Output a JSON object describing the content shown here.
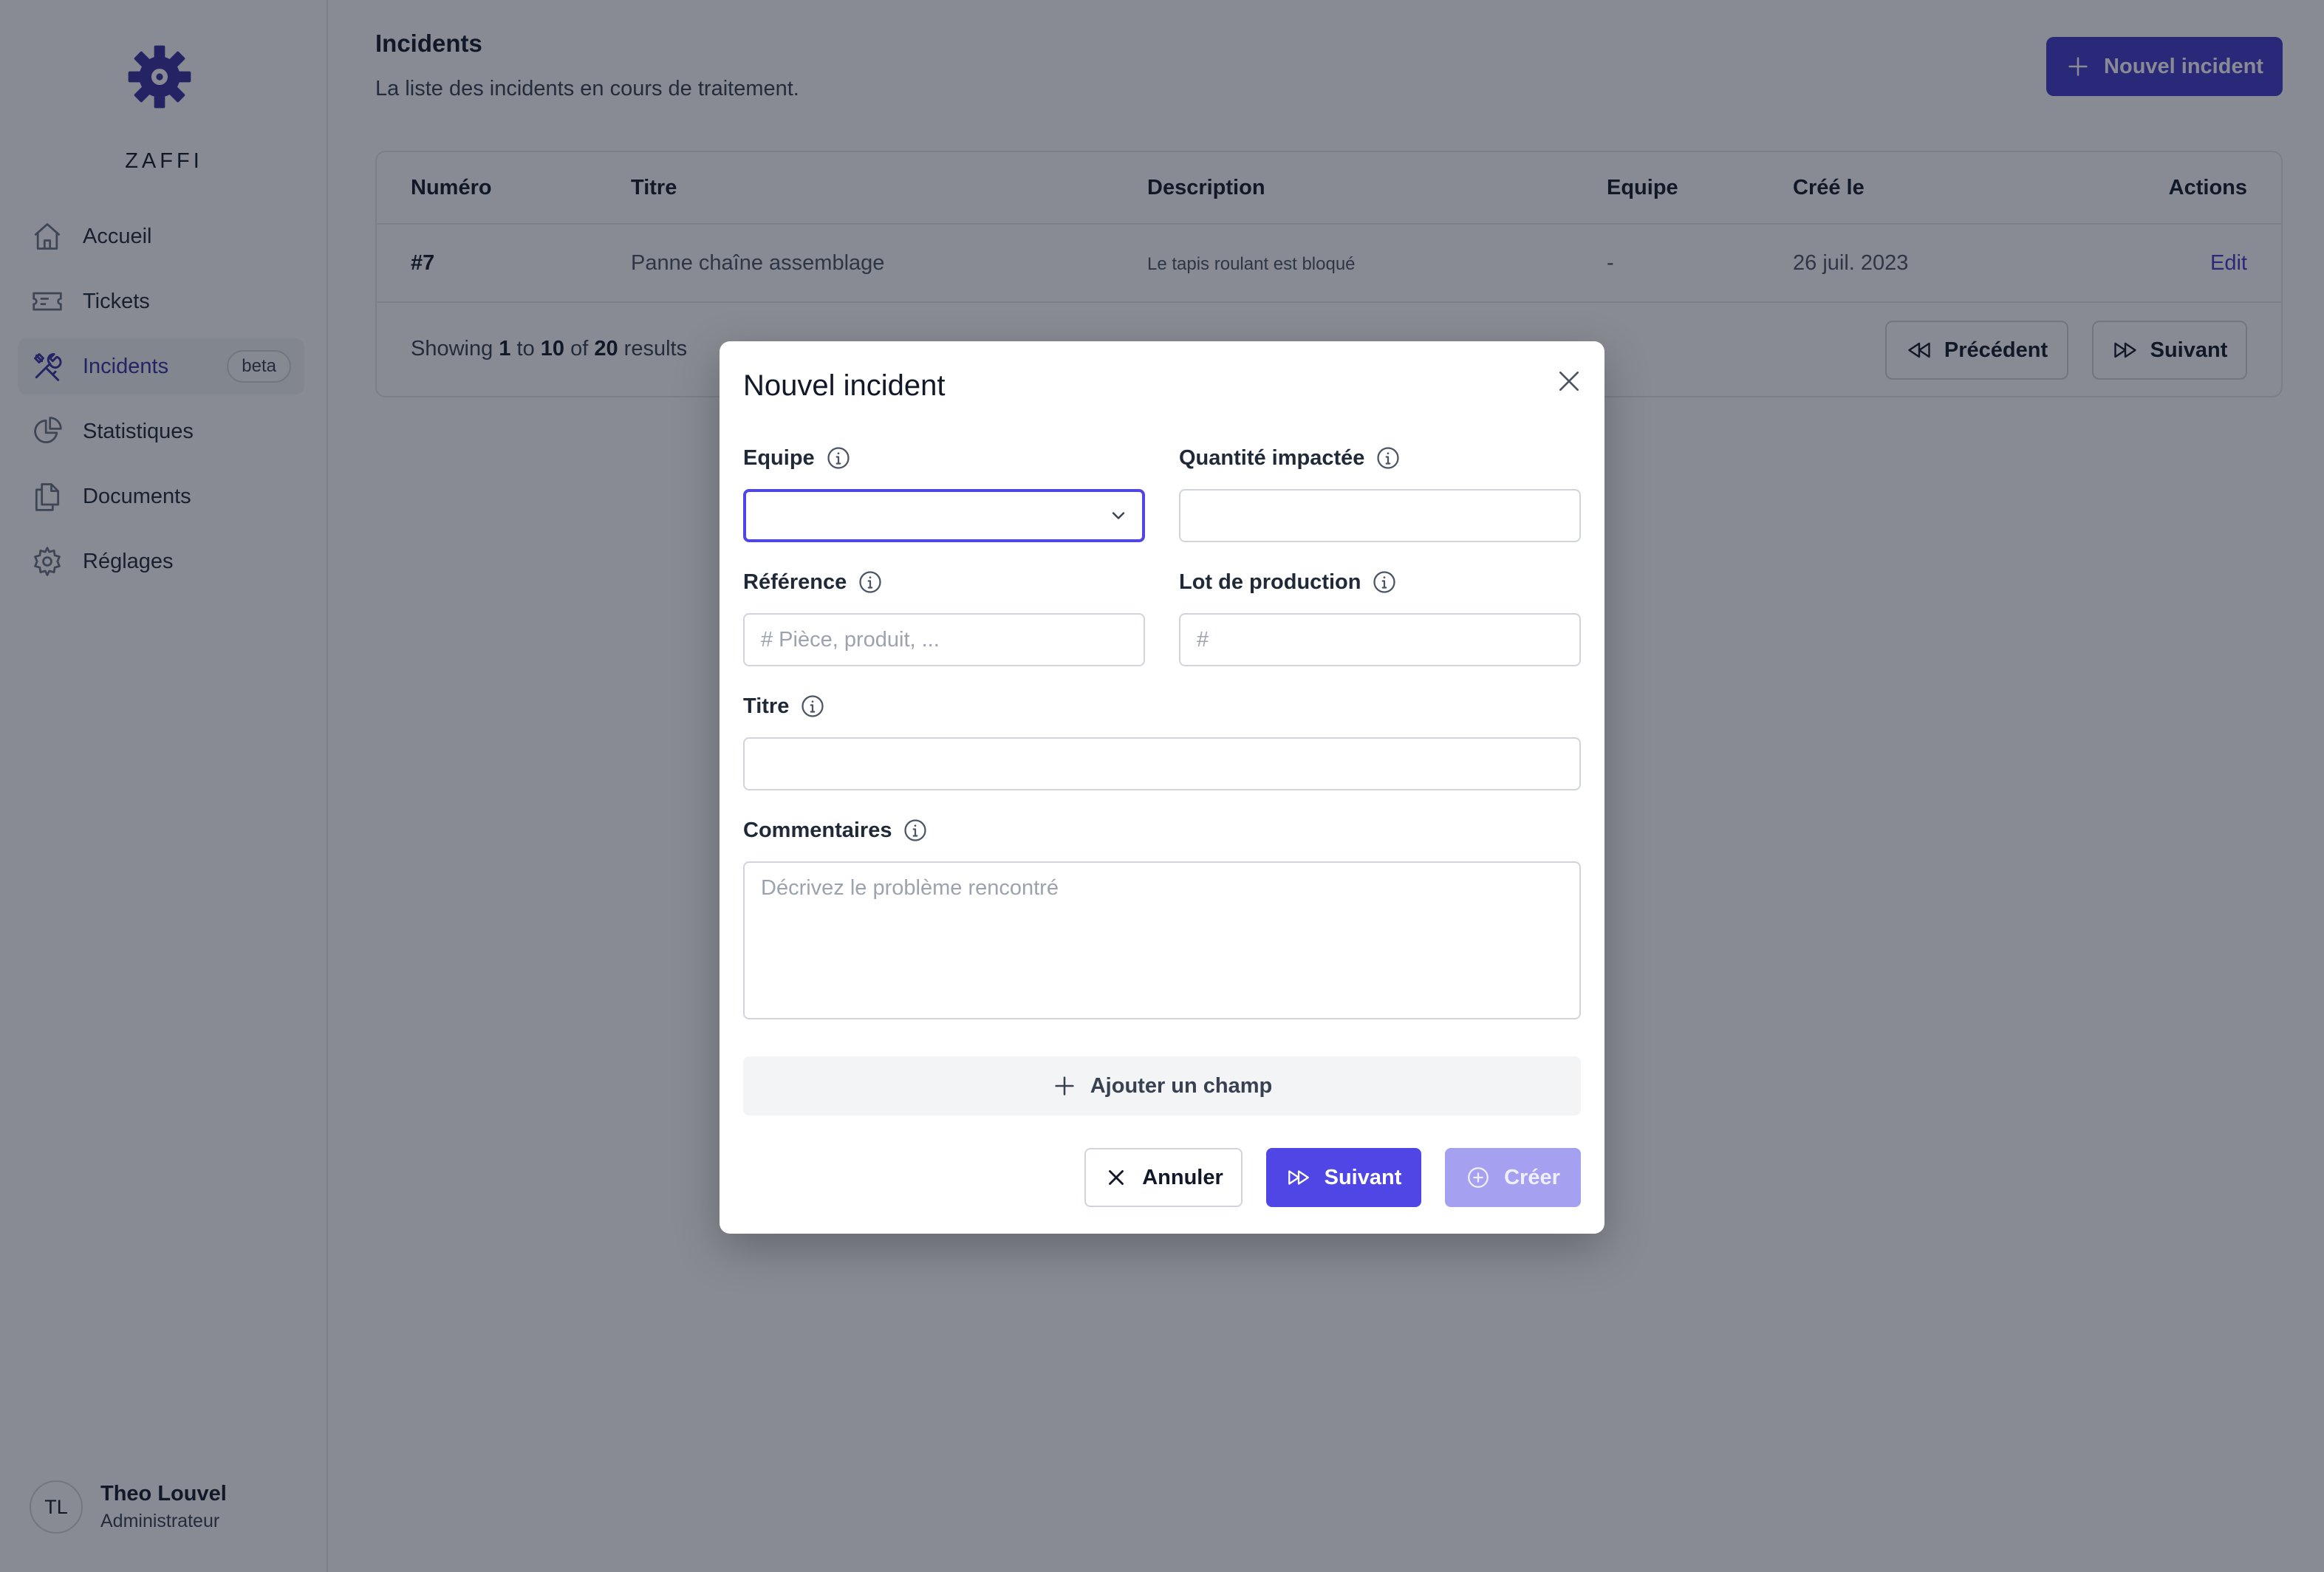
{
  "sidebar": {
    "brand": "ZAFFI",
    "items": [
      {
        "label": "Accueil",
        "icon": "home-icon"
      },
      {
        "label": "Tickets",
        "icon": "ticket-icon"
      },
      {
        "label": "Incidents",
        "icon": "tools-icon",
        "badge": "beta",
        "active": true
      },
      {
        "label": "Statistiques",
        "icon": "pie-chart-icon"
      },
      {
        "label": "Documents",
        "icon": "documents-icon"
      },
      {
        "label": "Réglages",
        "icon": "gear-icon"
      }
    ],
    "user": {
      "initials": "TL",
      "name": "Theo Louvel",
      "role": "Administrateur"
    }
  },
  "header": {
    "title": "Incidents",
    "subtitle": "La liste des incidents en cours de traitement.",
    "new_button": "Nouvel incident"
  },
  "table": {
    "columns": [
      "Numéro",
      "Titre",
      "Description",
      "Equipe",
      "Créé le",
      "Actions"
    ],
    "rows": [
      {
        "numero": "#7",
        "titre": "Panne chaîne assemblage",
        "description": "Le tapis roulant est bloqué",
        "equipe": "-",
        "cree_le": "26 juil. 2023",
        "action": "Edit"
      }
    ]
  },
  "pagination": {
    "showing_prefix": "Showing",
    "from": "1",
    "to_word": "to",
    "to": "10",
    "of_word": "of",
    "total": "20",
    "results_word": "results",
    "prev": "Précédent",
    "next": "Suivant"
  },
  "modal": {
    "title": "Nouvel incident",
    "fields": {
      "equipe": {
        "label": "Equipe",
        "value": ""
      },
      "quantite": {
        "label": "Quantité impactée",
        "value": "",
        "placeholder": ""
      },
      "reference": {
        "label": "Référence",
        "value": "",
        "placeholder": "# Pièce, produit, ..."
      },
      "lot": {
        "label": "Lot de production",
        "value": "",
        "placeholder": "#"
      },
      "titre": {
        "label": "Titre",
        "value": "",
        "placeholder": ""
      },
      "commentaires": {
        "label": "Commentaires",
        "value": "",
        "placeholder": "Décrivez le problème rencontré"
      }
    },
    "add_field": "Ajouter un champ",
    "cancel": "Annuler",
    "next": "Suivant",
    "create": "Créer"
  },
  "colors": {
    "accent": "#4f46e5",
    "accent_dark": "#4338ca",
    "accent_disabled": "#a5a0ef",
    "overlay": "#111827"
  }
}
